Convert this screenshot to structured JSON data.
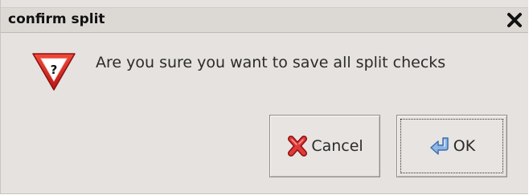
{
  "dialog": {
    "title": "confirm split",
    "message": "Are you sure you want to save all split checks",
    "icon": "warning-question-icon",
    "close_icon": "close-icon"
  },
  "buttons": {
    "cancel_label": "Cancel",
    "cancel_icon": "red-x-icon",
    "ok_label": "OK",
    "ok_icon": "return-arrow-icon"
  },
  "colors": {
    "background": "#e5e2df",
    "warning_red": "#d42020",
    "ok_icon_blue": "#6f9fd8"
  }
}
